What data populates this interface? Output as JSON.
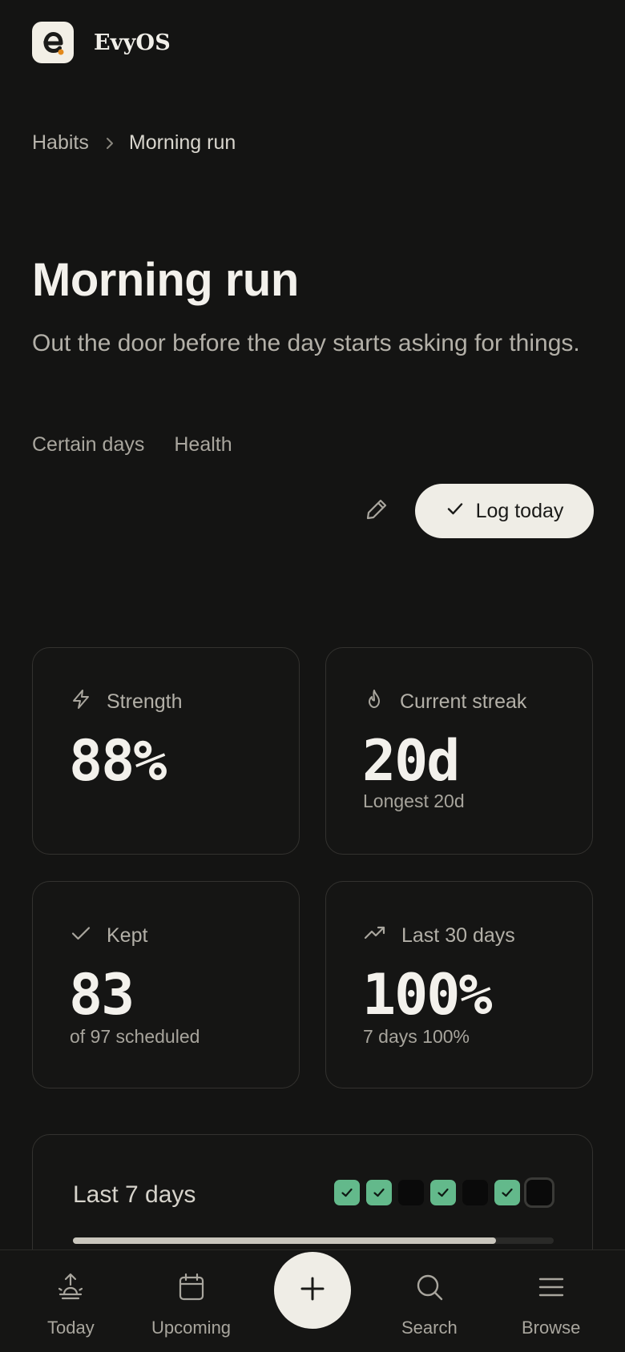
{
  "app": {
    "name": "EvyOS",
    "logo_icon": "evyos-logo-icon"
  },
  "breadcrumb": {
    "parent": "Habits",
    "current": "Morning run"
  },
  "habit": {
    "title": "Morning run",
    "description": "Out the door before the day starts asking for things.",
    "tags": [
      "Certain days",
      "Health"
    ]
  },
  "actions": {
    "edit_icon": "pencil-icon",
    "log_label": "Log today",
    "log_icon": "check-icon"
  },
  "stats": {
    "strength": {
      "label": "Strength",
      "value": "88%",
      "icon": "lightning-icon"
    },
    "streak": {
      "label": "Current streak",
      "value": "20d",
      "sub": "Longest 20d",
      "icon": "flame-icon"
    },
    "kept": {
      "label": "Kept",
      "value": "83",
      "sub": "of 97 scheduled",
      "icon": "check-icon"
    },
    "last30": {
      "label": "Last 30 days",
      "value": "100%",
      "sub": "7 days 100%",
      "icon": "trending-up-icon"
    }
  },
  "week": {
    "label": "Last 7 days",
    "days": [
      {
        "done": true
      },
      {
        "done": true
      },
      {
        "done": false
      },
      {
        "done": true
      },
      {
        "done": false
      },
      {
        "done": true
      },
      {
        "done": false,
        "today": true
      }
    ],
    "progress_fraction": 0.88
  },
  "tabbar": {
    "today": "Today",
    "upcoming": "Upcoming",
    "search": "Search",
    "browse": "Browse",
    "fab_icon": "plus-icon"
  },
  "colors": {
    "background": "#141413",
    "accent_done": "#63b98b",
    "button": "#efede6",
    "logo_dot": "#e38a1c"
  }
}
